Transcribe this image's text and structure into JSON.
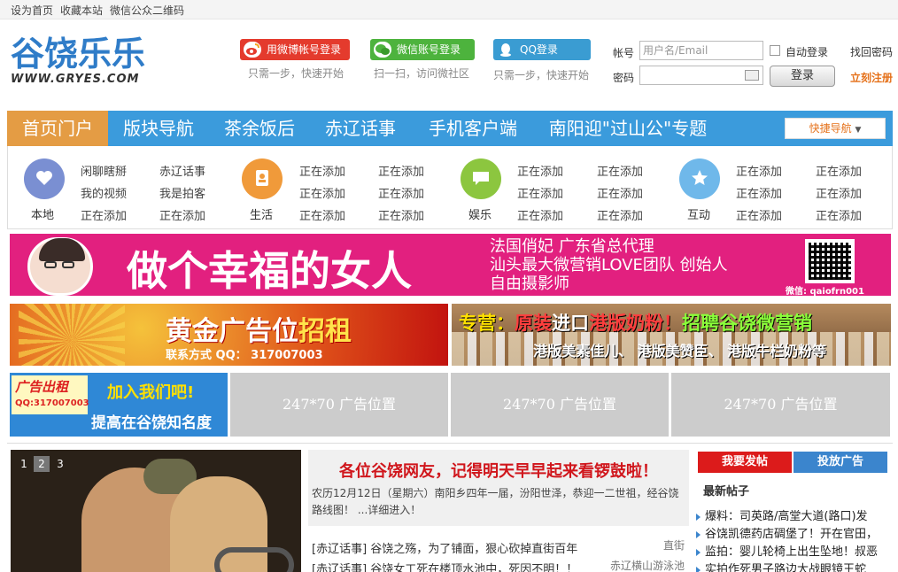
{
  "topbar": {
    "set_home": "设为首页",
    "bookmark": "收藏本站",
    "wechat_qr": "微信公众二维码"
  },
  "logo": {
    "name": "谷饶乐乐",
    "url": "WWW.GRYES.COM"
  },
  "social_login": {
    "weibo": {
      "label": "用微博帐号登录",
      "sub": "只需一步，快速开始"
    },
    "wechat": {
      "label": "微信账号登录",
      "sub": "扫一扫，访问微社区"
    },
    "qq": {
      "label": "QQ登录",
      "sub": "只需一步，快速开始"
    }
  },
  "account": {
    "username_label": "帐号",
    "username_placeholder": "用户名/Email",
    "password_label": "密码",
    "auto_login": "自动登录",
    "find_password": "找回密码",
    "login": "登录",
    "register": "立刻注册"
  },
  "nav": {
    "items": [
      "首页门户",
      "版块导航",
      "茶余饭后",
      "赤辽话事",
      "手机客户端",
      "南阳迎\"过山公\"专题"
    ],
    "active": 0,
    "quick_nav": "快捷导航"
  },
  "categories": [
    {
      "name": "本地",
      "color": "#7a8fd2",
      "links": [
        "闲聊瞎掰",
        "赤辽话事",
        "我的视频",
        "我是拍客",
        "正在添加",
        "正在添加"
      ]
    },
    {
      "name": "生活",
      "color": "#f09a3a",
      "links": [
        "正在添加",
        "正在添加",
        "正在添加",
        "正在添加",
        "正在添加",
        "正在添加"
      ]
    },
    {
      "name": "娱乐",
      "color": "#8cc63f",
      "links": [
        "正在添加",
        "正在添加",
        "正在添加",
        "正在添加",
        "正在添加",
        "正在添加"
      ]
    },
    {
      "name": "互动",
      "color": "#6fb8ea",
      "links": [
        "正在添加",
        "正在添加",
        "正在添加",
        "正在添加",
        "正在添加",
        "正在添加"
      ]
    }
  ],
  "banner_main": {
    "title": "做个幸福的女人",
    "lines": [
      "法国俏妃 广东省总代理",
      "汕头最大微营销LOVE团队 创始人",
      "自由摄影师"
    ],
    "wechat": "微信: qaiofrn001"
  },
  "banner_gold": {
    "title_a": "黄金广告位",
    "title_b": "招租",
    "contact": "联系方式 QQ： 317007003"
  },
  "banner_milk": {
    "line1_a": "专营：",
    "line1_b": "原装",
    "line1_c": "进口",
    "line1_d": "港版奶粉！",
    "line1_e": "招聘谷饶微营销",
    "line2": "港版美素佳儿、 港版美赞臣、 港版牛栏奶粉等"
  },
  "banner_join": {
    "tag": "广告出租",
    "qq": "QQ:317007003",
    "join": "加入我们吧!",
    "slogan": "提高在谷饶知名度"
  },
  "ad_slots": [
    "247*70 广告位置",
    "247*70 广告位置",
    "247*70 广告位置"
  ],
  "slider": {
    "pages": [
      "1",
      "2",
      "3"
    ],
    "active": 1
  },
  "news": {
    "headline": "各位谷饶网友，记得明天早早起来看锣鼓啦！",
    "summary": "农历12月12日（星期六）南阳乡四年一届，汾阳世泽，恭迎一二世祖，经谷饶路线图！ ...详细进入！",
    "rows": [
      {
        "text": "[赤辽话事] 谷饶之殇，为了铺面，狠心砍掉直街百年",
        "right": "直街"
      },
      {
        "text": "[赤辽话事] 谷饶女工死在楼顶水池中，死因不明！！",
        "right": "赤辽横山游泳池"
      }
    ]
  },
  "sidebar": {
    "post": "我要发帖",
    "advertise": "投放广告",
    "title": "最新帖子",
    "posts": [
      "爆料：司英路/高堂大道(路口)发",
      "谷饶凯德药店碉堡了！开在官田，",
      "监拍：婴儿轮椅上出生坠地！叔恶",
      "实拍作死男子路边大战眼镜王蛇"
    ]
  }
}
